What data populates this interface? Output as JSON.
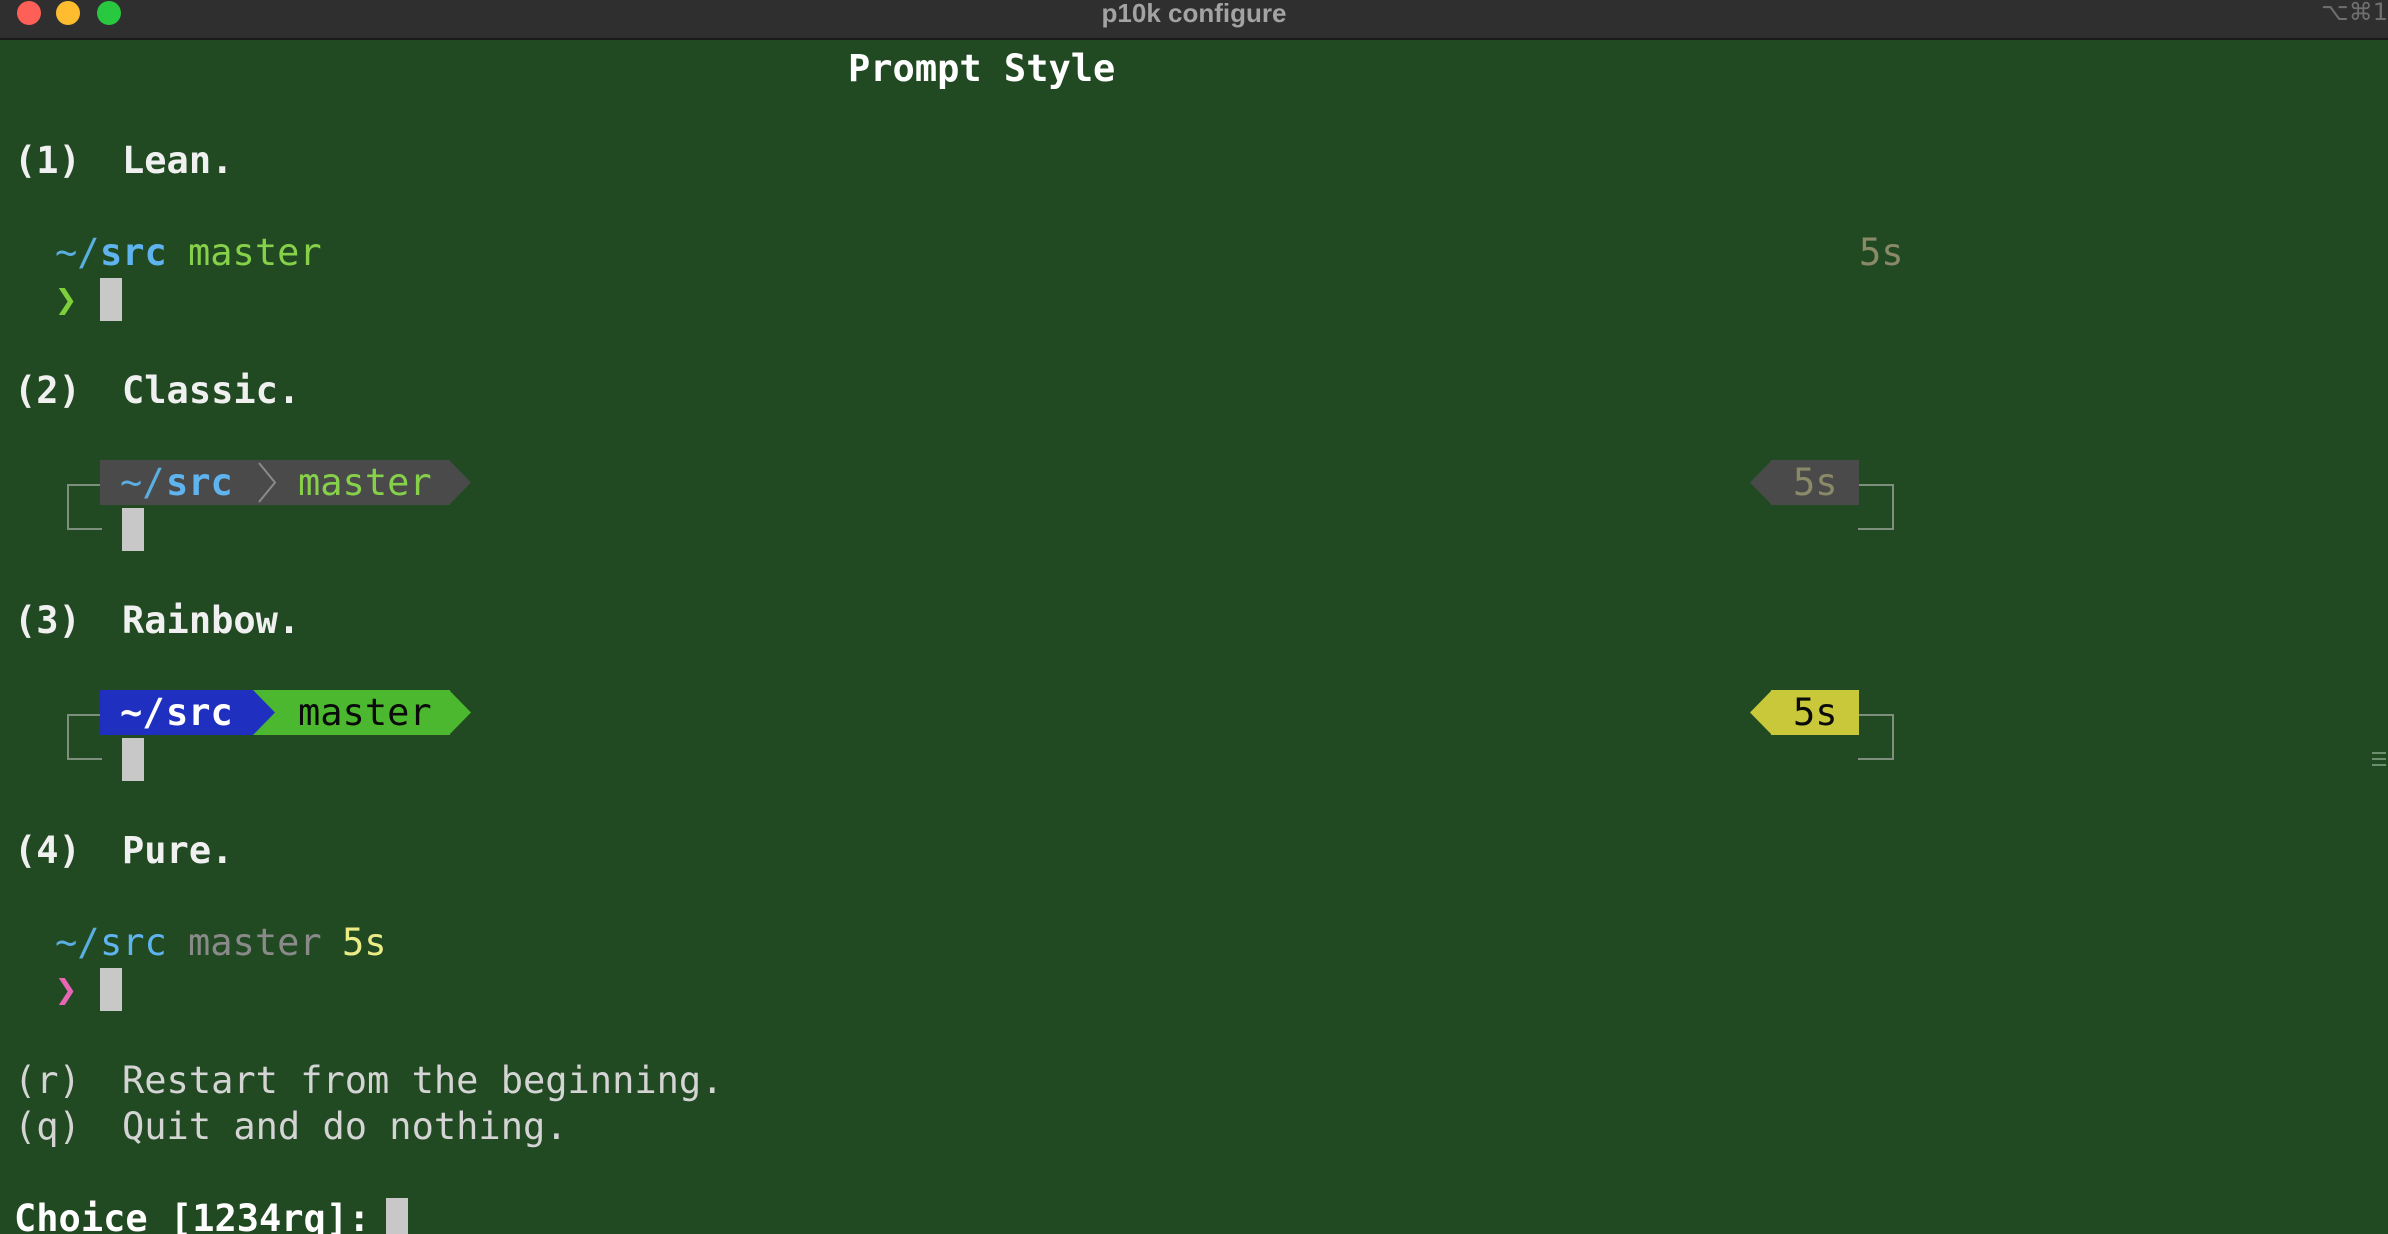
{
  "window": {
    "title": "p10k configure",
    "shortcut": "⌥⌘1",
    "controls": [
      "close",
      "minimize",
      "maximize"
    ]
  },
  "screen": {
    "heading": "Prompt Style",
    "options": [
      {
        "key": "(1)",
        "label": "Lean."
      },
      {
        "key": "(2)",
        "label": "Classic."
      },
      {
        "key": "(3)",
        "label": "Rainbow."
      },
      {
        "key": "(4)",
        "label": "Pure."
      }
    ],
    "preview": {
      "tilde": "~/",
      "dir": "src",
      "branch": "master",
      "duration": "5s",
      "prompt_char": "❯"
    },
    "extra_options": [
      {
        "key": "(r)",
        "label": "Restart from the beginning."
      },
      {
        "key": "(q)",
        "label": "Quit and do nothing."
      }
    ],
    "input": {
      "prompt": "Choice [1234rq]: ",
      "value": ""
    }
  },
  "colors": {
    "background": "#214a22",
    "lean_dir": "#5fb4f0",
    "lean_git": "#86d04a",
    "classic_segment": "#4a4a4a",
    "rainbow_dir_bg": "#1f30c0",
    "rainbow_git_bg": "#4cb82f",
    "rainbow_dur_bg": "#c8c83a",
    "pure_prompt": "#e865b6",
    "cursor": "#c8c8c8"
  }
}
